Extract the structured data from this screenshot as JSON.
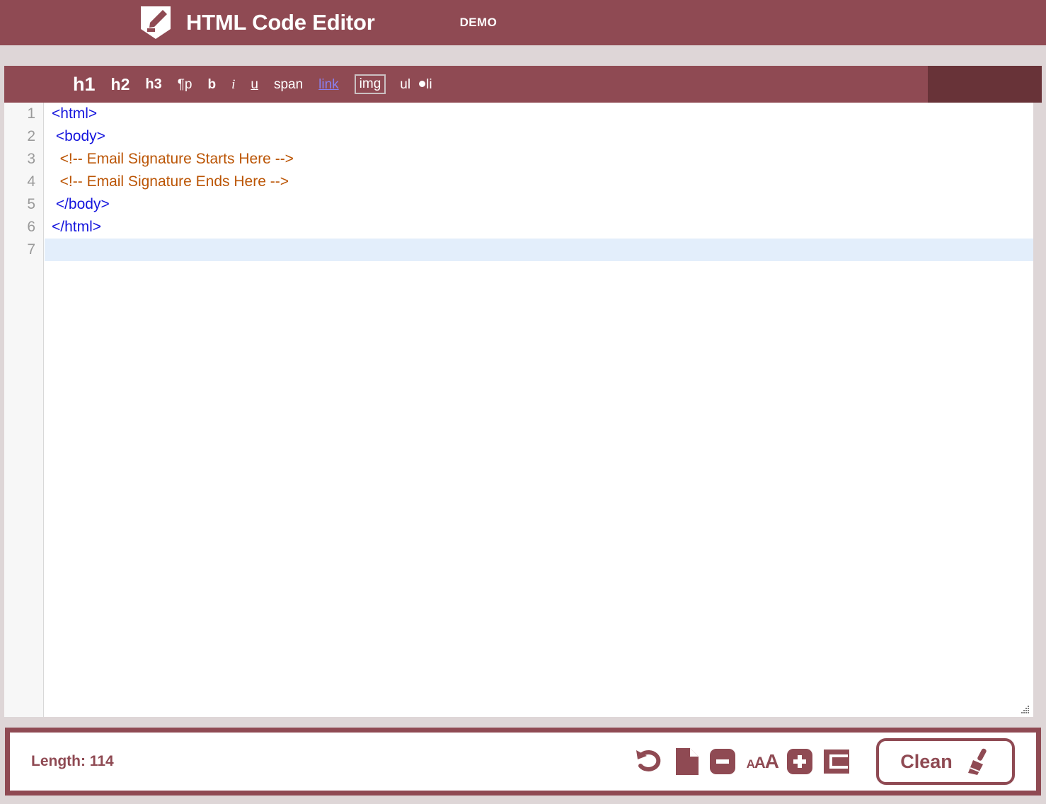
{
  "header": {
    "logo_icon": "html-editor-shield-pencil-icon",
    "title": "HTML Code Editor",
    "badge": "DEMO",
    "background_color": "#8f4a53"
  },
  "toolbar": {
    "background_color": "#8f4a53",
    "right_block_color": "#683338",
    "items": [
      {
        "label": "h1",
        "name": "toolbar-h1",
        "style": "h1"
      },
      {
        "label": "h2",
        "name": "toolbar-h2",
        "style": "h2"
      },
      {
        "label": "h3",
        "name": "toolbar-h3",
        "style": "h3"
      },
      {
        "label": "¶p",
        "name": "toolbar-p",
        "style": "p"
      },
      {
        "label": "b",
        "name": "toolbar-bold",
        "style": "b"
      },
      {
        "label": "i",
        "name": "toolbar-italic",
        "style": "i"
      },
      {
        "label": "u",
        "name": "toolbar-underline",
        "style": "u"
      },
      {
        "label": "span",
        "name": "toolbar-span",
        "style": "span"
      },
      {
        "label": "link",
        "name": "toolbar-link",
        "style": "link"
      },
      {
        "label": "img",
        "name": "toolbar-img",
        "style": "img"
      },
      {
        "label": "ul",
        "name": "toolbar-ul",
        "style": "ul"
      },
      {
        "label": "li",
        "name": "toolbar-li",
        "style": "li"
      }
    ]
  },
  "editor": {
    "line_numbers": [
      "1",
      "2",
      "3",
      "4",
      "5",
      "6",
      "7"
    ],
    "lines": [
      {
        "text": "<html>",
        "kind": "tag",
        "active": false
      },
      {
        "text": " <body>",
        "kind": "tag",
        "active": false
      },
      {
        "text": "  <!-- Email Signature Starts Here -->",
        "kind": "comment",
        "active": false
      },
      {
        "text": "  <!-- Email Signature Ends Here -->",
        "kind": "comment",
        "active": false
      },
      {
        "text": " </body>",
        "kind": "tag",
        "active": false
      },
      {
        "text": "</html>",
        "kind": "tag",
        "active": false
      },
      {
        "text": "",
        "kind": "tag",
        "active": true
      }
    ],
    "tag_color": "#1515dd",
    "comment_color": "#bb5505",
    "active_line_color": "#e3eefb",
    "resize_grip_icon": "resize-grip-icon"
  },
  "footer": {
    "length_label": "Length: 114",
    "tools": [
      {
        "name": "undo-button",
        "icon": "undo-icon"
      },
      {
        "name": "new-document-button",
        "icon": "new-document-icon"
      },
      {
        "name": "font-decrease-button",
        "icon": "minus-icon"
      },
      {
        "name": "font-size-label",
        "icon": "aaa-icon",
        "a1": "A",
        "a2": "A",
        "a3": "A"
      },
      {
        "name": "font-increase-button",
        "icon": "plus-icon"
      },
      {
        "name": "fullscreen-button",
        "icon": "fullscreen-icon"
      }
    ],
    "clean_button": {
      "label": "Clean",
      "icon": "broom-icon"
    },
    "accent_color": "#8f4a53"
  },
  "page": {
    "background_color": "#ded6d7"
  }
}
